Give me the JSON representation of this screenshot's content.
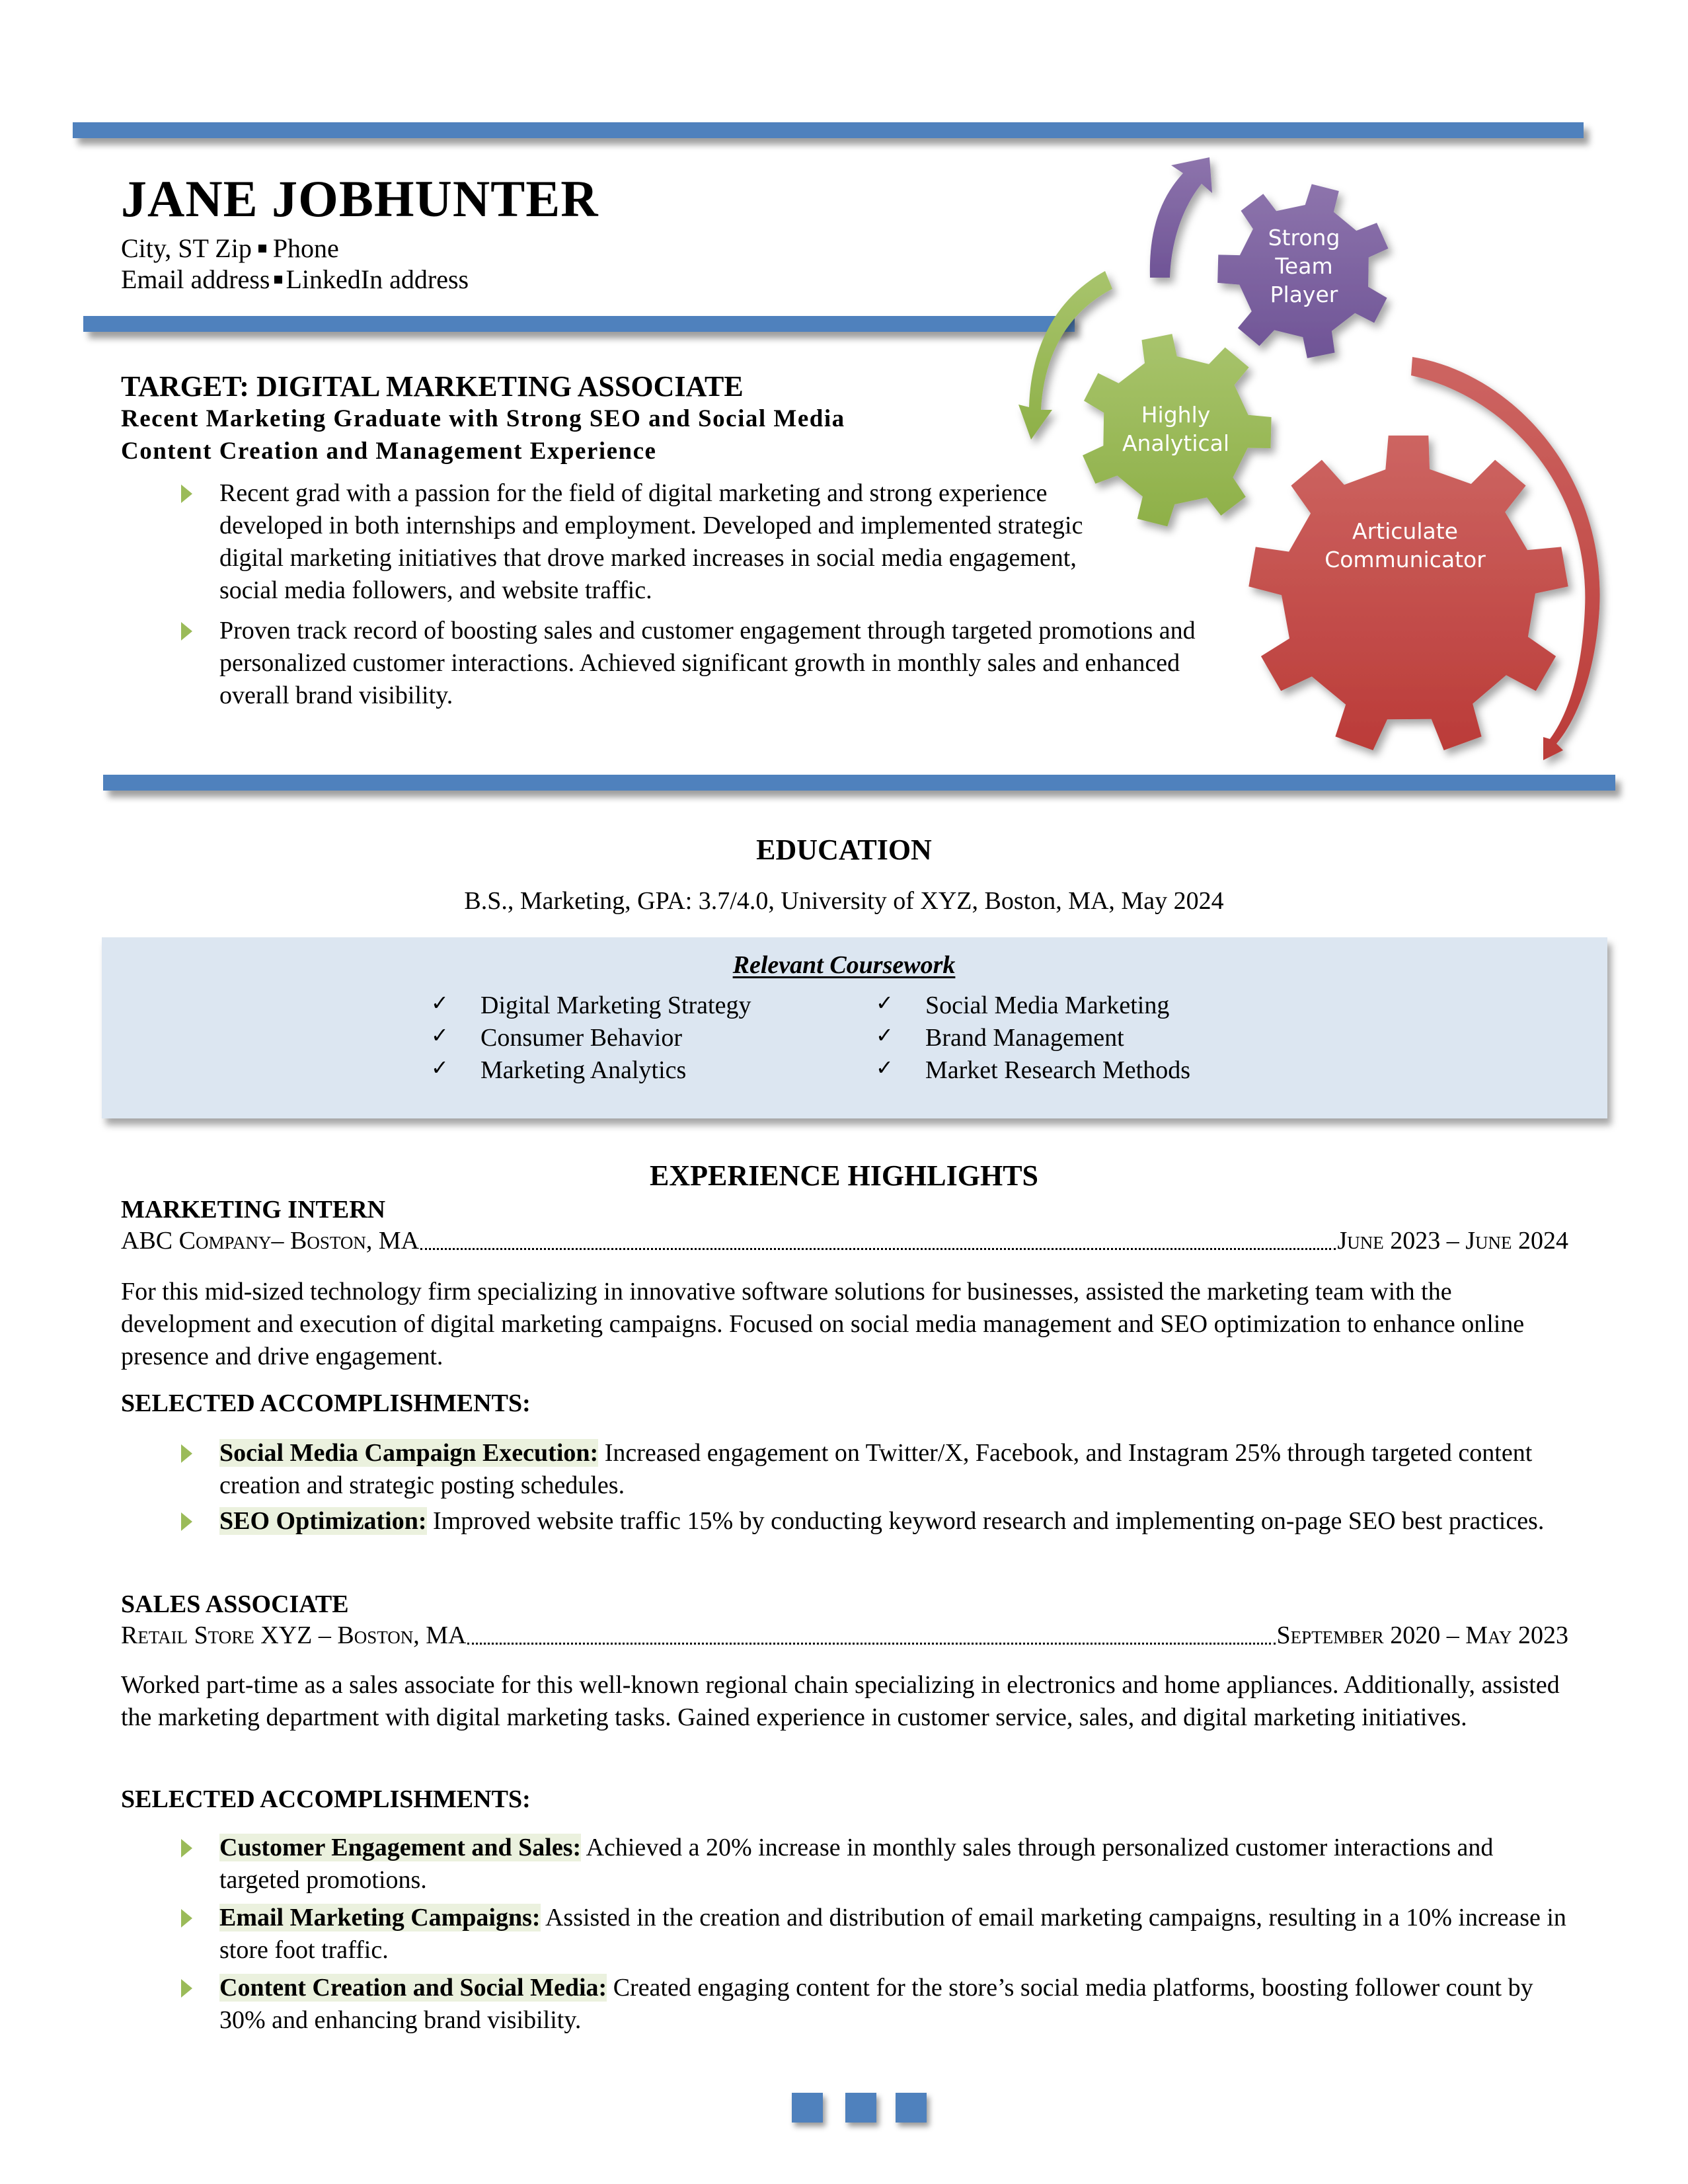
{
  "header": {
    "name": "JANE JOBHUNTER",
    "contact_line1": {
      "city": "City, ST Zip",
      "phone": "Phone"
    },
    "contact_line2": {
      "email": "Email address",
      "linkedin": "LinkedIn address"
    }
  },
  "gears": [
    {
      "label_lines": [
        "Strong",
        "Team",
        "Player"
      ],
      "color": "#8064a2"
    },
    {
      "label_lines": [
        "Highly",
        "Analytical"
      ],
      "color": "#9bbb59"
    },
    {
      "label_lines": [
        "Articulate",
        "Communicator"
      ],
      "color": "#c0504d"
    }
  ],
  "target": {
    "title": "TARGET: DIGITAL MARKETING ASSOCIATE",
    "subtitle_line1": "Recent Marketing Graduate with Strong SEO and Social Media",
    "subtitle_line2": "Content Creation and Management Experience",
    "bullets": [
      "Recent grad with a passion for the field of digital marketing and strong experience developed in both internships and employment. Developed and implemented strategic digital marketing initiatives that drove marked increases in social media engagement, social media followers, and website traffic.",
      "Proven track record of boosting sales and customer engagement through targeted promotions and personalized customer interactions. Achieved significant growth in monthly sales and enhanced overall brand visibility."
    ]
  },
  "education": {
    "heading": "EDUCATION",
    "degree": "B.S., Marketing, GPA: 3.7/4.0, University of XYZ, Boston, MA, May 2024",
    "coursework_title": "Relevant Coursework",
    "coursework": [
      "Digital Marketing Strategy",
      "Consumer Behavior",
      "Marketing Analytics",
      "Social Media Marketing",
      "Brand Management",
      "Market Research Methods"
    ]
  },
  "experience": {
    "heading": "EXPERIENCE HIGHLIGHTS",
    "jobs": [
      {
        "title": "MARKETING INTERN",
        "company": "ABC Company– Boston, MA",
        "dates": "June 2023 – June 2024",
        "description": "For this mid-sized technology firm specializing in innovative software solutions for businesses, assisted the marketing team with the development and execution of digital marketing campaigns. Focused on social media management and SEO optimization to enhance online presence and drive engagement.",
        "accomplishments_heading": "SELECTED ACCOMPLISHMENTS:",
        "accomplishments": [
          {
            "label": "Social Media Campaign Execution:",
            "text": " Increased engagement on Twitter/X, Facebook, and Instagram 25% through targeted content creation and strategic posting schedules."
          },
          {
            "label": "SEO Optimization:",
            "text": " Improved website traffic 15% by conducting keyword research and implementing on-page SEO best practices."
          }
        ]
      },
      {
        "title": "SALES ASSOCIATE",
        "company": "Retail Store XYZ – Boston, MA",
        "dates": "September 2020 – May 2023",
        "description": "Worked part-time as a sales associate for this well-known regional chain specializing in electronics and home appliances. Additionally, assisted the marketing department with digital marketing tasks. Gained experience in customer service, sales, and digital marketing initiatives.",
        "accomplishments_heading": "SELECTED ACCOMPLISHMENTS:",
        "accomplishments": [
          {
            "label": "Customer Engagement and Sales:",
            "text": " Achieved a 20% increase in monthly sales through personalized customer interactions and targeted promotions."
          },
          {
            "label": "Email Marketing Campaigns:",
            "text": " Assisted in the creation and distribution of email marketing campaigns, resulting in a 10% increase in store foot traffic."
          },
          {
            "label": "Content Creation and Social Media:",
            "text": " Created engaging content for the store’s social media platforms, boosting follower count by 30% and enhancing brand visibility."
          }
        ]
      }
    ]
  },
  "colors": {
    "accent_blue": "#4f81bd",
    "bullet_green": "#9bbb59",
    "highlight": "#ebf1de",
    "coursework_box": "#dce6f1"
  }
}
